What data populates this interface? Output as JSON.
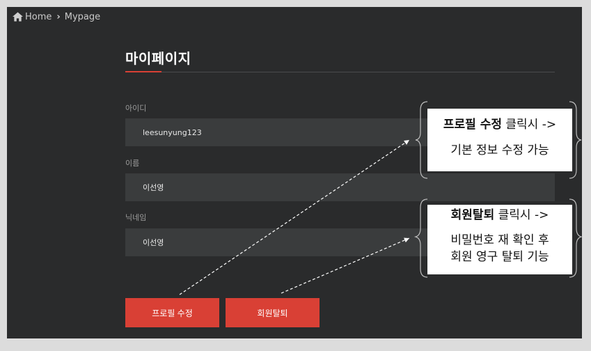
{
  "breadcrumb": {
    "home": "Home",
    "current": "Mypage"
  },
  "page": {
    "title": "마이페이지"
  },
  "fields": [
    {
      "label": "아이디",
      "value": "leesunyung123"
    },
    {
      "label": "이름",
      "value": "이선영"
    },
    {
      "label": "닉네임",
      "value": "이선영"
    }
  ],
  "buttons": {
    "edit": "프로필 수정",
    "withdraw": "회원탈퇴"
  },
  "annotations": {
    "edit": {
      "bold": "프로필 수정",
      "rest": " 클릭시 ->",
      "line2": "기본 정보 수정 가능"
    },
    "withdraw": {
      "bold": "회원탈퇴",
      "rest": " 클릭시 ->",
      "line2": "비밀번호 재 확인 후",
      "line3": "회원 영구 탈퇴 기능"
    }
  },
  "colors": {
    "accent": "#d94035",
    "background": "#2a2b2c",
    "field": "#3a3c3d"
  }
}
